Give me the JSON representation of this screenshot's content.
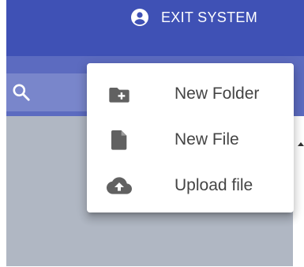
{
  "header": {
    "exit_label": "EXIT SYSTEM",
    "exit_icon": "account-circle-icon"
  },
  "search": {
    "icon": "search-icon"
  },
  "menu": {
    "items": [
      {
        "label": "New Folder",
        "icon": "new-folder-icon"
      },
      {
        "label": "New File",
        "icon": "file-icon"
      },
      {
        "label": "Upload file",
        "icon": "cloud-upload-icon"
      }
    ]
  },
  "colors": {
    "appbar": "#3f51b5",
    "toolbar": "#5c6bc0",
    "search_box": "#7986cb",
    "content": "#b0b7c3",
    "menu_icon": "#616161",
    "menu_text": "#444444"
  }
}
